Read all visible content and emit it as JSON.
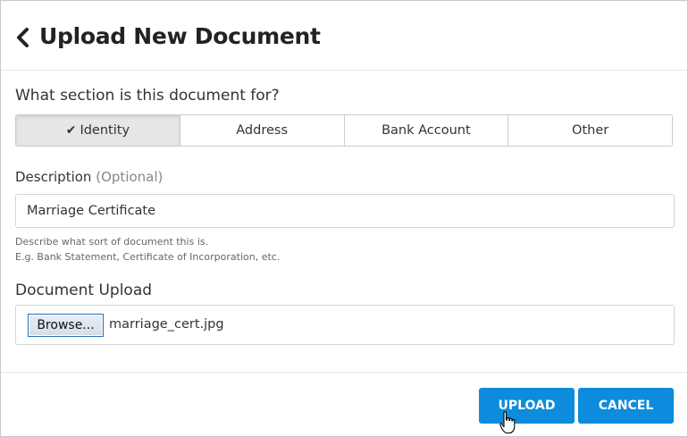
{
  "dialog": {
    "title": "Upload New Document",
    "back_icon": "chevron-left-icon"
  },
  "section": {
    "question": "What section is this document for?",
    "options": [
      {
        "label": "Identity",
        "selected": true
      },
      {
        "label": "Address",
        "selected": false
      },
      {
        "label": "Bank Account",
        "selected": false
      },
      {
        "label": "Other",
        "selected": false
      }
    ]
  },
  "description": {
    "label": "Description",
    "optional_tag": "(Optional)",
    "value": "Marriage Certificate",
    "help_line1": "Describe what sort of document this is.",
    "help_line2": "E.g. Bank Statement, Certificate of Incorporation, etc."
  },
  "upload": {
    "label": "Document Upload",
    "browse_label": "Browse...",
    "file_name": "marriage_cert.jpg"
  },
  "footer": {
    "upload_label": "UPLOAD",
    "cancel_label": "CANCEL"
  },
  "colors": {
    "accent": "#0d8bdc",
    "selected_segment": "#e6e6e6"
  }
}
